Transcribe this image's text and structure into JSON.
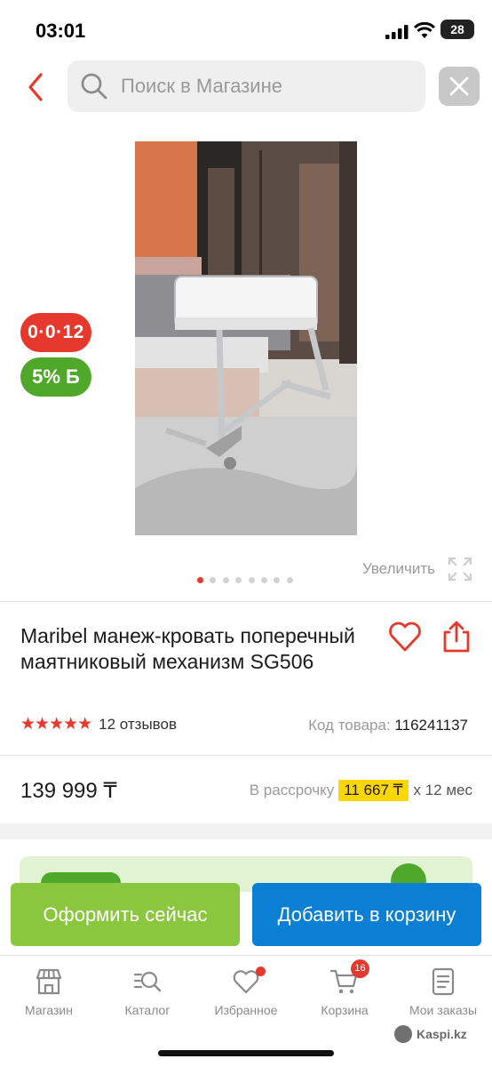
{
  "status_bar": {
    "time": "03:01",
    "battery": "28"
  },
  "search": {
    "placeholder": "Поиск в Магазине"
  },
  "gallery": {
    "installment_badge": "0·0·12",
    "bonus_badge": "5% Б",
    "zoom_label": "Увеличить",
    "dot_count": 8,
    "active_dot": 0
  },
  "product": {
    "title": "Maribel манеж-кровать поперечный маятниковый механизм SG506",
    "rating": 4.5,
    "reviews": "12 отзывов",
    "code_label": "Код товара:",
    "code": "116241137",
    "price": "139 999 ₸",
    "installment_label": "В рассрочку",
    "installment_amount": "11 667 ₸",
    "installment_term": "х 12 мес"
  },
  "actions": {
    "buy_now": "Оформить сейчас",
    "add_to_cart": "Добавить в корзину"
  },
  "tabbar": {
    "items": [
      {
        "label": "Магазин",
        "icon": "store-icon"
      },
      {
        "label": "Каталог",
        "icon": "catalog-search-icon"
      },
      {
        "label": "Избранное",
        "icon": "heart-icon",
        "dot": true
      },
      {
        "label": "Корзина",
        "icon": "cart-icon",
        "count": "16"
      },
      {
        "label": "Мои заказы",
        "icon": "orders-icon"
      }
    ]
  },
  "watermark": "Kaspi.kz",
  "colors": {
    "accent_red": "#e5392d",
    "green": "#8bc63f",
    "blue": "#0a7fd4",
    "highlight": "#ffd600"
  }
}
